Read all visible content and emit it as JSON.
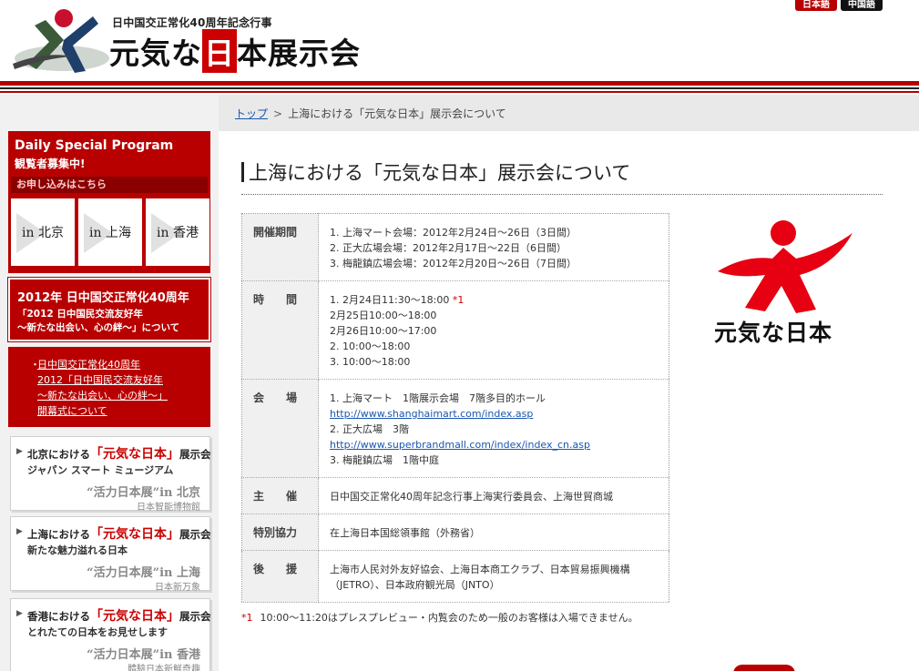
{
  "header": {
    "subtitle": "日中国交正常化40周年記念行事",
    "title_pre": "元気な",
    "title_hi": "日",
    "title_post": "本展示会",
    "lang_jp": "日本語",
    "lang_cn": "中国語",
    "logo_icon": "genki-figure-icon"
  },
  "breadcrumb": {
    "home": "トップ",
    "separator": ">",
    "current": "上海における「元気な日本」展示会について"
  },
  "sidebar": {
    "daily": {
      "title": "Daily Special Program",
      "subtitle": "観覧者募集中!",
      "apply": "お申し込みはこちら",
      "cities": [
        "in 北京",
        "in 上海",
        "in 香港"
      ]
    },
    "year2012": {
      "line1": "2012年 日中国交正常化40周年",
      "line2": "「2012 日中国民交流友好年",
      "line3": "～新たな出会い、心の絆～」について"
    },
    "opening": {
      "bullet": "・",
      "lines": [
        "日中国交正常化40周年",
        "2012「日中国民交流友好年",
        "～新たな出会い、心の絆～」",
        "開幕式について"
      ]
    },
    "expos": [
      {
        "pre": "北京における",
        "red": "「元気な日本」",
        "post": "展示会",
        "sub": "ジャパン スマート ミュージアム",
        "cn1": "“活力日本展”in 北京",
        "cn2": "日本智能博物館"
      },
      {
        "pre": "上海における",
        "red": "「元気な日本」",
        "post": "展示会",
        "sub": "新たな魅力溢れる日本",
        "cn1": "“活力日本展”in 上海",
        "cn2": "日本新万象"
      },
      {
        "pre": "香港における",
        "red": "「元気な日本」",
        "post": "展示会",
        "sub": "とれたての日本をお見せします",
        "cn1": "“活力日本展”in 香港",
        "cn2": "體驗日本新鮮奇趣"
      }
    ]
  },
  "main": {
    "title": "上海における「元気な日本」展示会について",
    "rows": [
      {
        "label": "開催期間",
        "lines": [
          "1. 上海マート会場：2012年2月24日～26日（3日間）",
          "2. 正大広場会場：2012年2月17日～22日（6日間）",
          "3. 梅龍鎮広場会場：2012年2月20日～26日（7日間）"
        ]
      },
      {
        "label": "時　　間",
        "first": "1. 2月24日11:30～18:00",
        "first_note": "*1",
        "lines": [
          "2月25日10:00～18:00",
          "2月26日10:00～17:00",
          "2. 10:00～18:00",
          "3. 10:00～18:00"
        ]
      },
      {
        "label": "会　　場",
        "l1": "1. 上海マート　1階展示会場　7階多目的ホール",
        "link1": "http://www.shanghaimart.com/index.asp",
        "l2": "2. 正大広場　3階",
        "link2": "http://www.superbrandmall.com/index/index_cn.asp",
        "l3": "3. 梅龍鎮広場　1階中庭"
      },
      {
        "label": "主　　催",
        "lines": [
          "日中国交正常化40周年記念行事上海実行委員会、上海世貿商城"
        ]
      },
      {
        "label": "特別協力",
        "lines": [
          "在上海日本国総領事館（外務省）"
        ]
      },
      {
        "label": "後　　援",
        "lines": [
          "上海市人民対外友好協会、上海日本商工クラブ、日本貿易振興機構",
          "（JETRO）、日本政府観光局（JNTO）"
        ]
      }
    ],
    "footnote_mark": "*1",
    "footnote": "10:00～11:20はプレスプレビュー・内覧会のため一般のお客様は入場できません。",
    "logo_text": "元気な日本"
  },
  "colors": {
    "brand_red": "#b80000",
    "link": "#1a56b0"
  }
}
